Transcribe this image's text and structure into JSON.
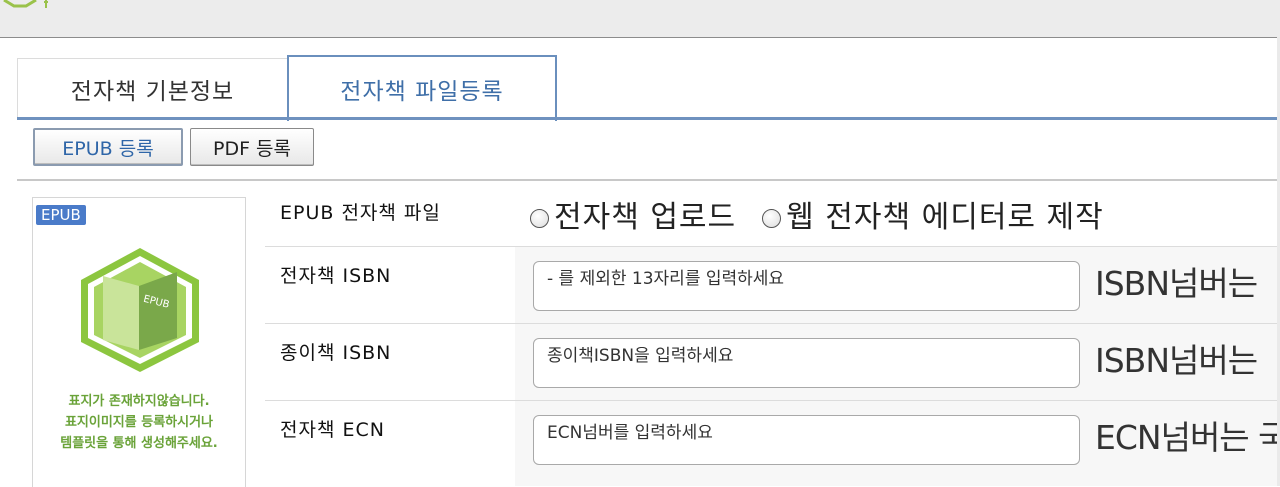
{
  "tabs": [
    {
      "label": "전자책 기본정보"
    },
    {
      "label": "전자책 파일등록"
    }
  ],
  "subtabs": {
    "epub_label": "EPUB 등록",
    "pdf_label": "PDF 등록"
  },
  "cover": {
    "badge": "EPUB",
    "icon_label": "EPUB",
    "message_lines": [
      "표지가 존재하지않습니다.",
      "표지이미지를 등록하시거나",
      "템플릿을 통해 생성해주세요."
    ]
  },
  "form": {
    "epub_file": {
      "label": "EPUB 전자책 파일",
      "options": [
        "전자책 업로드",
        "웹 전자책 에디터로 제작"
      ]
    },
    "ebook_isbn": {
      "label": "전자책 ISBN",
      "placeholder": "- 를 제외한 13자리를 입력하세요",
      "hint": "ISBN넘버는"
    },
    "paper_isbn": {
      "label": "종이책 ISBN",
      "placeholder": "종이책ISBN을 입력하세요",
      "hint": "ISBN넘버는"
    },
    "ebook_ecn": {
      "label": "전자책 ECN",
      "placeholder": "ECN넘버를 입력하세요",
      "hint": "ECN넘버는 국"
    }
  },
  "colors": {
    "accent_blue": "#3f6fa8",
    "cover_green": "#8cc63f",
    "badge_blue": "#4a7bc9"
  }
}
